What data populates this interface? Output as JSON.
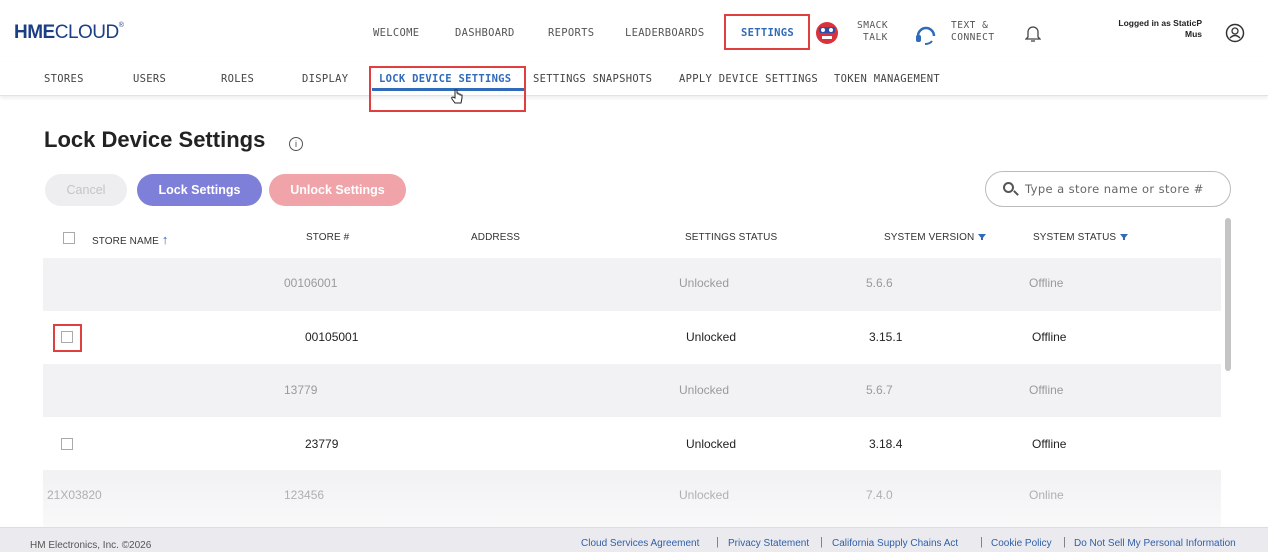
{
  "header": {
    "logo_bold": "HME",
    "logo_light": "CLOUD",
    "logo_mark": "®",
    "nav": [
      "WELCOME",
      "DASHBOARD",
      "REPORTS",
      "LEADERBOARDS",
      "SETTINGS"
    ],
    "active_nav": "SETTINGS",
    "smack_talk_line1": "SMACK",
    "smack_talk_line2": "TALK",
    "text_connect_line1": "TEXT &",
    "text_connect_line2": "CONNECT",
    "logged_in_line1": "Logged in as StaticP",
    "logged_in_line2": "Mus",
    "icons": [
      "mascot-icon",
      "headset-icon",
      "bell-icon",
      "user-icon"
    ]
  },
  "subnav": {
    "items": [
      "STORES",
      "USERS",
      "ROLES",
      "DISPLAY",
      "LOCK DEVICE SETTINGS",
      "SETTINGS SNAPSHOTS",
      "APPLY DEVICE SETTINGS",
      "TOKEN MANAGEMENT"
    ],
    "active": "LOCK DEVICE SETTINGS"
  },
  "page": {
    "title": "Lock Device Settings",
    "info_glyph": "i",
    "cancel_label": "Cancel",
    "lock_label": "Lock Settings",
    "unlock_label": "Unlock Settings",
    "search_placeholder": "Type a store name or store #"
  },
  "table": {
    "columns": [
      "STORE NAME",
      "STORE #",
      "ADDRESS",
      "SETTINGS STATUS",
      "SYSTEM VERSION",
      "SYSTEM STATUS"
    ],
    "sort_arrow": "↑",
    "rows": [
      {
        "name": "",
        "store": "00106001",
        "address": "",
        "status": "Unlocked",
        "version": "5.6.6",
        "system": "Offline"
      },
      {
        "name": "",
        "store": "00105001",
        "address": "",
        "status": "Unlocked",
        "version": "3.15.1",
        "system": "Offline"
      },
      {
        "name": "",
        "store": "13779",
        "address": "",
        "status": "Unlocked",
        "version": "5.6.7",
        "system": "Offline"
      },
      {
        "name": "",
        "store": "23779",
        "address": "",
        "status": "Unlocked",
        "version": "3.18.4",
        "system": "Offline"
      },
      {
        "name": "21X03820",
        "store": "123456",
        "address": "",
        "status": "Unlocked",
        "version": "7.4.0",
        "system": "Online"
      }
    ]
  },
  "footer": {
    "copyright": "HM Electronics, Inc. ©2026",
    "links": [
      "Cloud Services Agreement",
      "Privacy Statement",
      "California Supply Chains Act",
      "Cookie Policy",
      "Do Not Sell My Personal Information"
    ],
    "separator": "|"
  },
  "colors": {
    "brand": "#1b3e84",
    "accent": "#2f6bb8",
    "highlight": "#e03f3f",
    "lock_button": "#7d7fd8",
    "unlock_button": "#f0a3a8"
  }
}
